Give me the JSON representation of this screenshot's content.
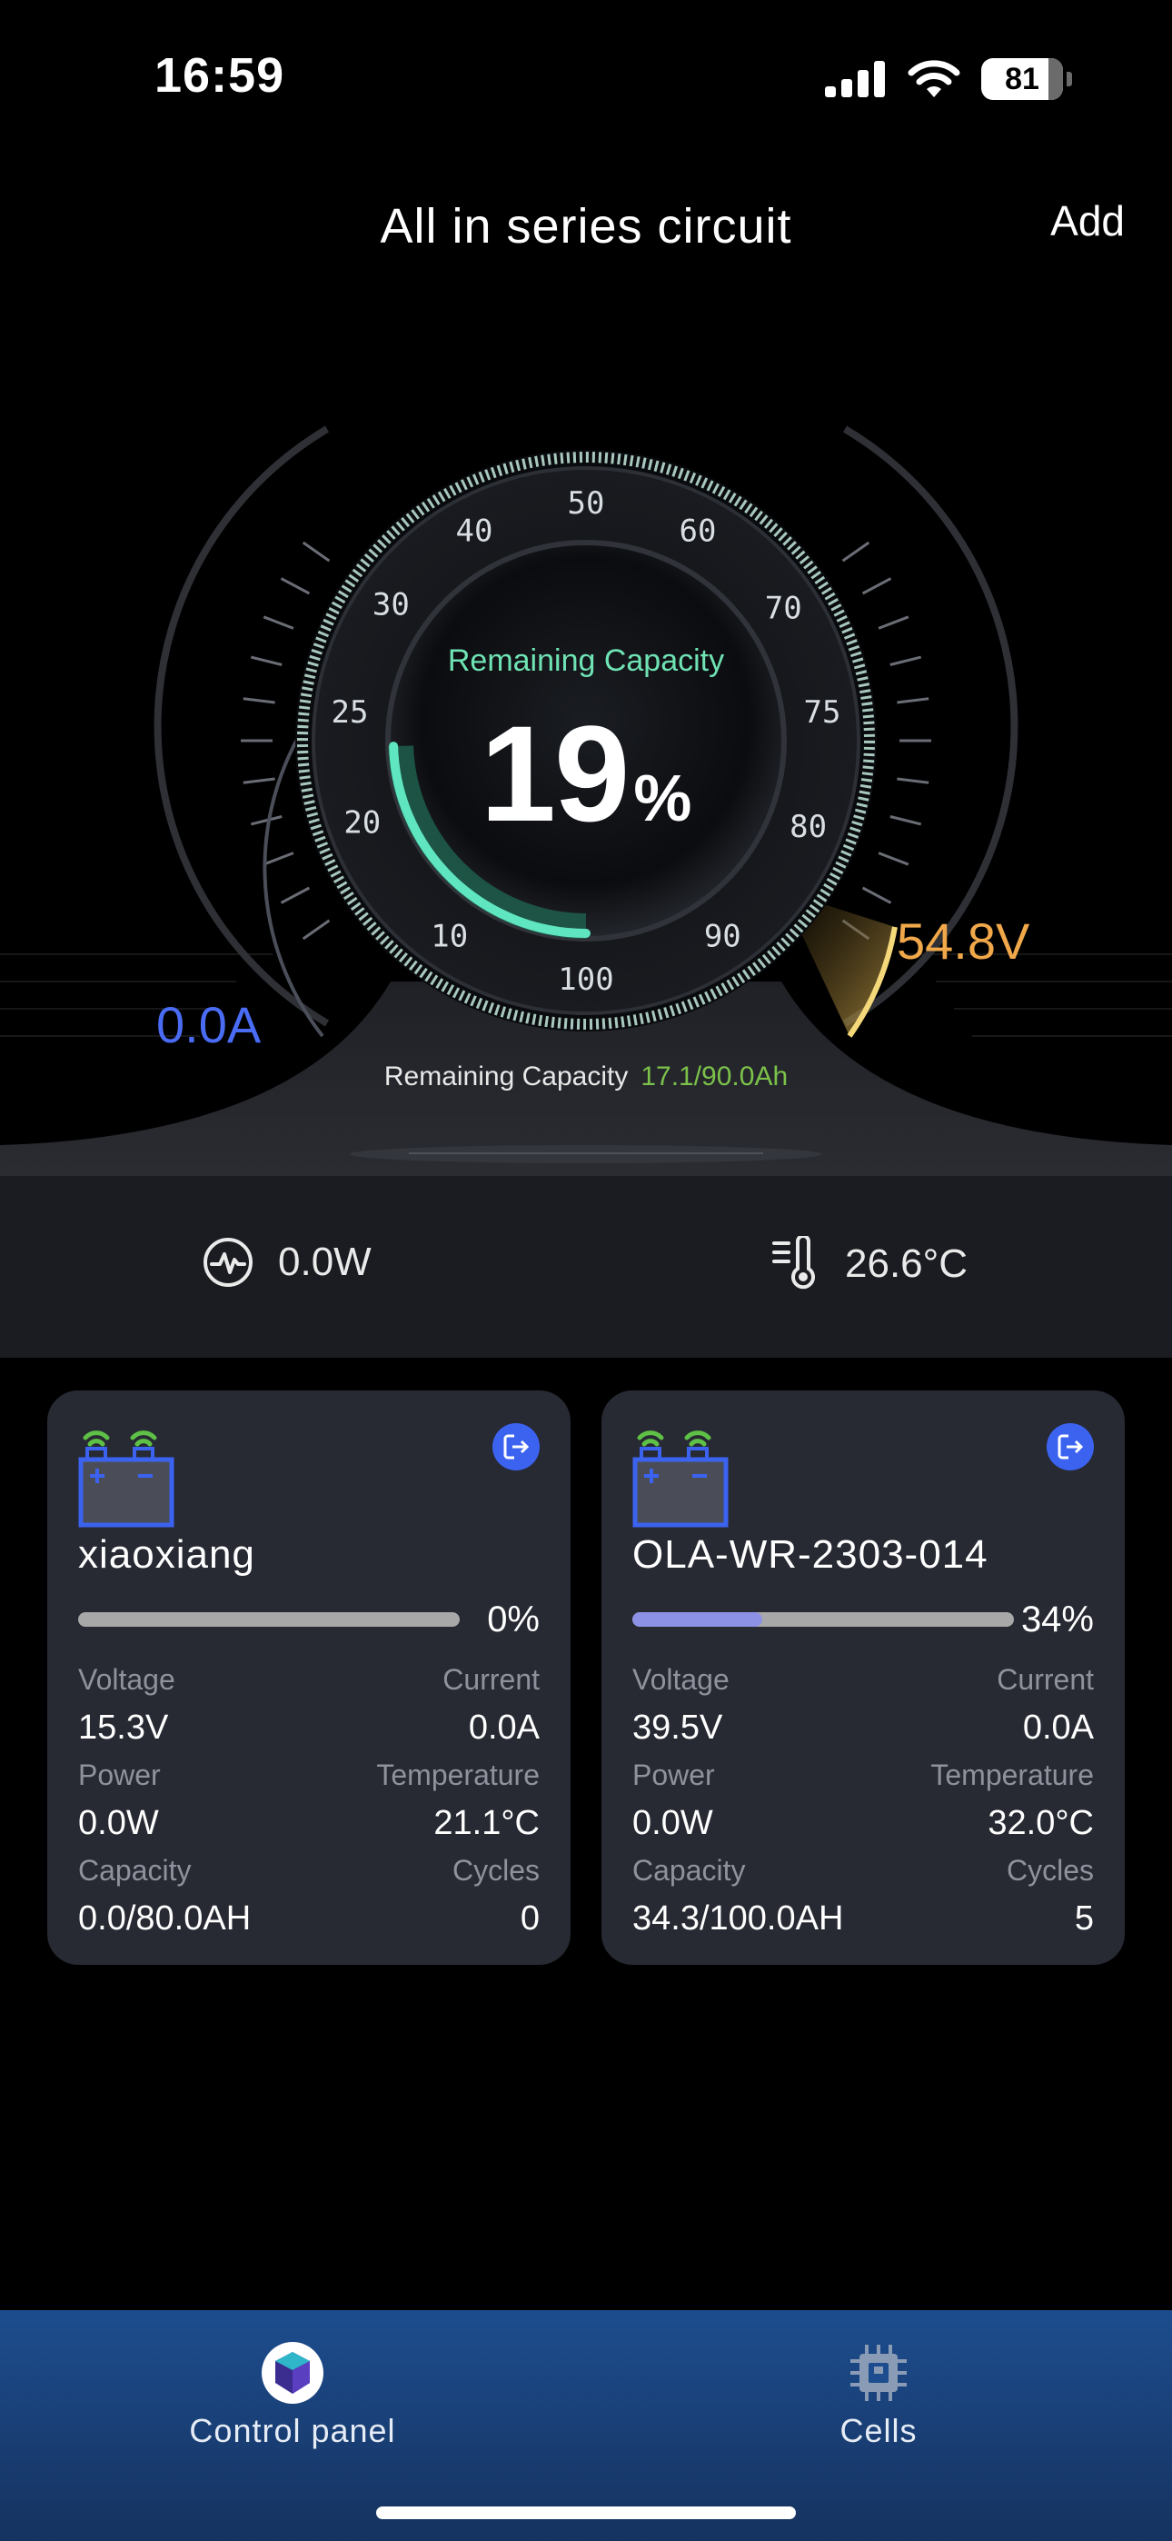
{
  "status_bar": {
    "time": "16:59",
    "battery_level": "81",
    "battery_fraction": 0.81,
    "icons": [
      "signal-icon",
      "wifi-icon",
      "battery-icon"
    ]
  },
  "header": {
    "title": "All in series circuit",
    "add_label": "Add"
  },
  "gauge": {
    "caption": "Remaining Capacity",
    "percent_value": "19",
    "percent_unit": "%",
    "percent_fraction": 0.19,
    "scale_labels": [
      "10",
      "20",
      "25",
      "30",
      "40",
      "50",
      "60",
      "70",
      "75",
      "80",
      "90",
      "100"
    ],
    "current": "0.0A",
    "voltage": "54.8V",
    "remaining_label": "Remaining Capacity",
    "remaining_value": "17.1/90.0Ah"
  },
  "stats": {
    "power": "0.0W",
    "temperature": "26.6°C"
  },
  "devices": [
    {
      "name": "xiaoxiang",
      "percent": "0%",
      "fill_fraction": 0.0,
      "voltage_label": "Voltage",
      "voltage": "15.3V",
      "current_label": "Current",
      "current": "0.0A",
      "power_label": "Power",
      "power": "0.0W",
      "temperature_label": "Temperature",
      "temperature": "21.1°C",
      "capacity_label": "Capacity",
      "capacity": "0.0/80.0AH",
      "cycles_label": "Cycles",
      "cycles": "0"
    },
    {
      "name": "OLA-WR-2303-014",
      "percent": "34%",
      "fill_fraction": 0.34,
      "voltage_label": "Voltage",
      "voltage": "39.5V",
      "current_label": "Current",
      "current": "0.0A",
      "power_label": "Power",
      "power": "0.0W",
      "temperature_label": "Temperature",
      "temperature": "32.0°C",
      "capacity_label": "Capacity",
      "capacity": "34.3/100.0AH",
      "cycles_label": "Cycles",
      "cycles": "5"
    }
  ],
  "tab_bar": {
    "tabs": [
      {
        "label": "Control panel",
        "icon": "cube-icon",
        "active": true
      },
      {
        "label": "Cells",
        "icon": "chip-icon",
        "active": false
      }
    ]
  },
  "colors": {
    "accent_green": "#6fe3b4",
    "current_blue": "#4a6cf4",
    "voltage_orange": "#f0a84a",
    "capacity_green": "#7cc24a",
    "card_bg": "#272a33",
    "tab_bar": "#1d4d8e"
  }
}
